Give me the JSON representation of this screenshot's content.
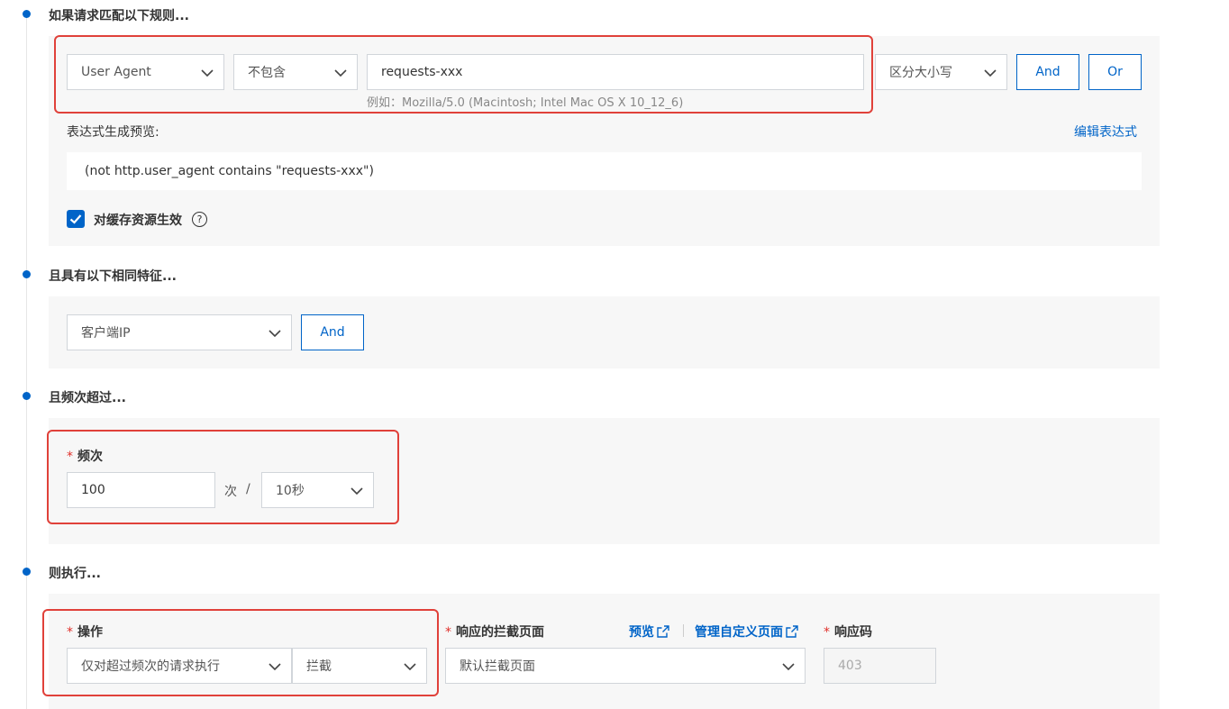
{
  "sections": {
    "match_rules": "如果请求匹配以下规则...",
    "same_features": "且具有以下相同特征...",
    "frequency_exceed": "且频次超过...",
    "then_execute": "则执行..."
  },
  "rule": {
    "field_select": "User Agent",
    "operator_select": "不包含",
    "value_input": "requests-xxx",
    "example_hint": "例如：Mozilla/5.0 (Macintosh; Intel Mac OS X 10_12_6)",
    "case_select": "区分大小写",
    "and_label": "And",
    "or_label": "Or",
    "preview_label": "表达式生成预览:",
    "edit_expression_link": "编辑表达式",
    "expression_preview": "(not http.user_agent contains \"requests-xxx\")",
    "cache_checkbox_label": "对缓存资源生效",
    "cache_checked": true,
    "help_glyph": "?"
  },
  "features": {
    "feature_select": "客户端IP",
    "and_label": "And"
  },
  "frequency": {
    "label": "频次",
    "count_value": "100",
    "unit_times": "次",
    "slash": "/",
    "period_select": "10秒"
  },
  "action": {
    "operation_label": "操作",
    "scope_select": "仅对超过频次的请求执行",
    "action_select": "拦截",
    "block_page_label": "响应的拦截页面",
    "preview_link": "预览",
    "manage_link": "管理自定义页面",
    "block_page_select": "默认拦截页面",
    "response_code_label": "响应码",
    "response_code_value": "403"
  },
  "required_mark": "*",
  "colors": {
    "accent": "#0064c8",
    "highlight_box": "#e0413a",
    "required": "#e0302b",
    "panel_bg": "#f7f7f7"
  },
  "icons": {
    "chevron": "chevron-down-icon",
    "external": "external-link-icon",
    "check": "check-icon",
    "help": "question-circle-icon"
  }
}
